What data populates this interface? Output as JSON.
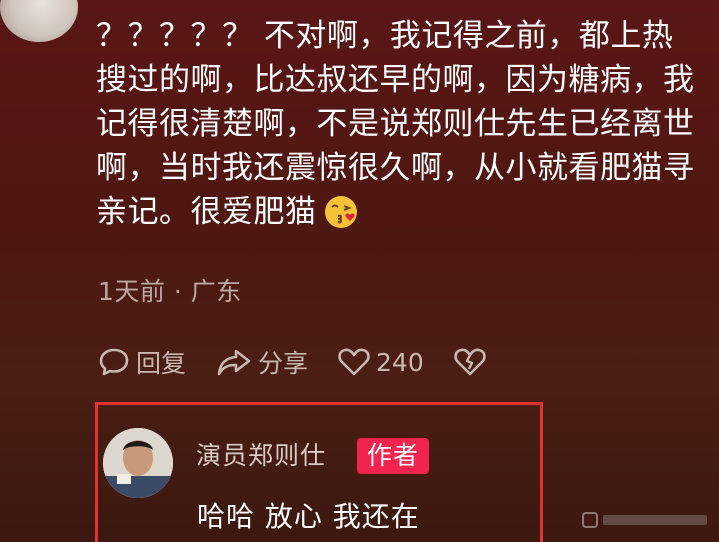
{
  "comment": {
    "text": "？？？？？ 不对啊，我记得之前，都上热搜过的啊，比达叔还早的啊，因为糖病，我记得很清楚啊，不是说郑则仕先生已经离世啊，当时我还震惊很久啊，从小就看肥猫寻亲记。很爱肥猫",
    "emoji": "face-blowing-kiss",
    "time": "1天前",
    "separator": "·",
    "location": "广东"
  },
  "actions": {
    "reply_label": "回复",
    "share_label": "分享",
    "like_count": "240"
  },
  "reply": {
    "author_name": "演员郑则仕",
    "author_badge": "作者",
    "text": "哈哈 放心 我还在"
  },
  "colors": {
    "highlight_border": "#e1342e",
    "badge_bg": "#f2244f"
  }
}
